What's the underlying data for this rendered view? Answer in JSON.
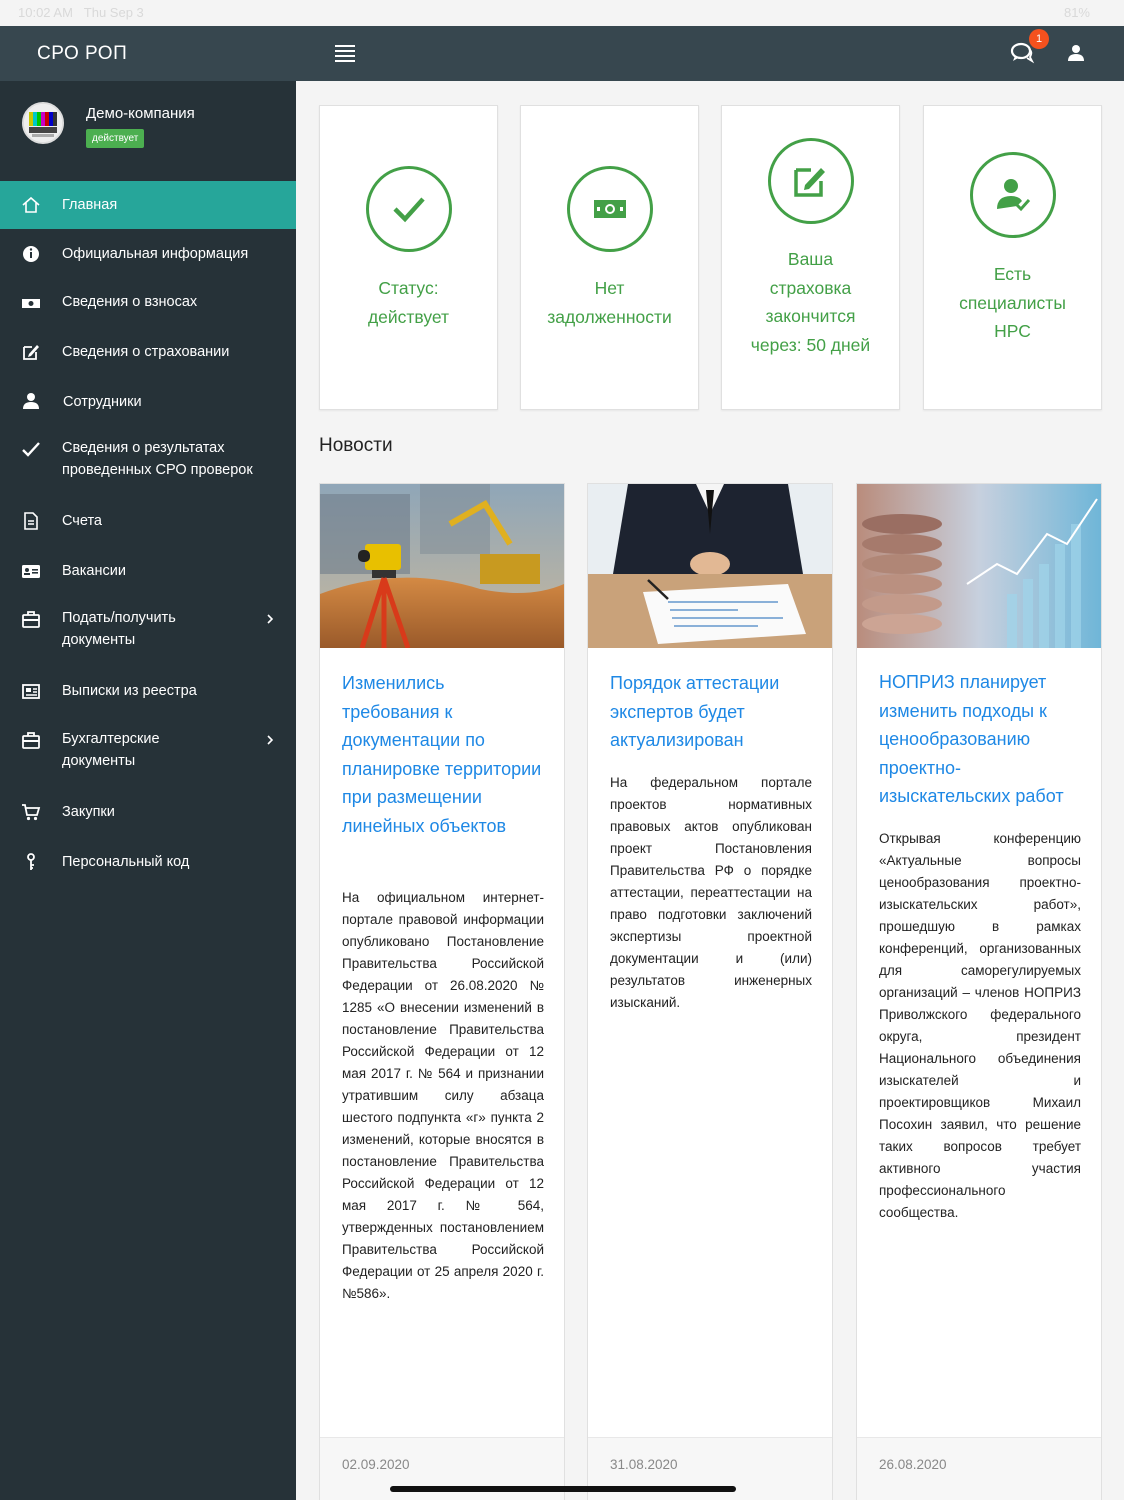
{
  "status_bar": {
    "time": "10:02 AM",
    "date": "Thu Sep 3",
    "battery": "81%"
  },
  "topbar": {
    "brand": "СРО РОП",
    "notification_count": "1"
  },
  "company": {
    "name": "Демо-компания",
    "status": "действует"
  },
  "menu": [
    {
      "label": "Главная",
      "icon": "home-icon"
    },
    {
      "label": "Официальная информация",
      "icon": "info-icon"
    },
    {
      "label": "Сведения о взносах",
      "icon": "money-icon"
    },
    {
      "label": "Сведения о страховании",
      "icon": "edit-icon"
    },
    {
      "label": "Сотрудники",
      "icon": "users-icon"
    },
    {
      "label": "Сведения о результатах\nпроведенных СРО проверок",
      "icon": "check-icon"
    },
    {
      "label": "Счета",
      "icon": "file-icon"
    },
    {
      "label": "Вакансии",
      "icon": "id-card-icon"
    },
    {
      "label": "Подать/получить\nдокументы",
      "icon": "briefcase-icon"
    },
    {
      "label": "Выписки из реестра",
      "icon": "newspaper-icon"
    },
    {
      "label": "Бухгалтерские\nдокументы",
      "icon": "briefcase-icon"
    },
    {
      "label": "Закупки",
      "icon": "cart-icon"
    },
    {
      "label": "Персональный код",
      "icon": "key-icon"
    }
  ],
  "status_cards": [
    {
      "text": "Статус:\nдействует",
      "icon": "check-icon"
    },
    {
      "text": "Нет\nзадолженности",
      "icon": "money-icon"
    },
    {
      "text": "Ваша\nстраховка\nзакончится\nчерез: 50 дней",
      "icon": "edit-icon"
    },
    {
      "text": "Есть\nспециалисты\nНРС",
      "icon": "user-check-icon"
    }
  ],
  "news_heading": "Новости",
  "news": [
    {
      "title": "Изменились требования к документации по планировке территории при размещении линейных объектов",
      "text": "На официальном интернет-портале правовой информации опубликовано Постановление Правительства Российской Федерации от 26.08.2020 № 1285 «О внесении изменений в постановление Правительства Российской Федерации от 12 мая 2017 г. № 564 и признании утратившим силу абзаца шестого подпункта «г» пункта 2 изменений, которые вносятся в постановление Правительства Российской Федерации от 12 мая 2017 г. № 564, утвержденных постановлением Правительства Российской Федерации от 25 апреля 2020 г. №586».",
      "date": "02.09.2020"
    },
    {
      "title": "Порядок аттестации экспертов будет актуализирован",
      "text": "На федеральном портале проектов нормативных правовых актов опубликован проект Постановления Правительства РФ о порядке аттестации, переаттестации на право подготовки заключений экспертизы проектной документации и (или) результатов инженерных изысканий.",
      "date": "31.08.2020"
    },
    {
      "title": "НОПРИЗ планирует изменить подходы к ценообразованию проектно-изыскательских работ",
      "text": "Открывая конференцию «Актуальные вопросы ценообразования проектно-изыскательских работ», прошедшую в рамках конференций, организованных для саморегулируемых организаций – членов НОПРИЗ Приволжского федерального округа, президент Национального объединения изыскателей и проектировщиков Михаил Посохин заявил, что решение таких вопросов требует активного участия профессионального сообщества.",
      "date": "26.08.2020"
    }
  ]
}
